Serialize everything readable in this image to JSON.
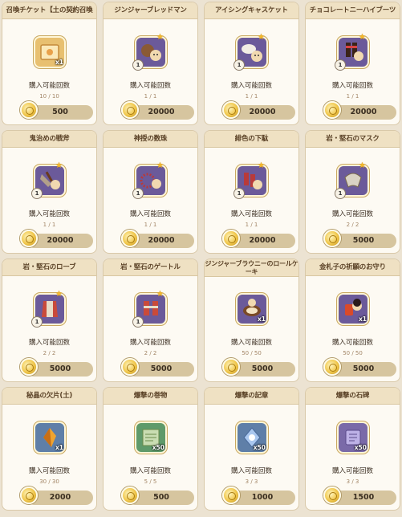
{
  "shop": {
    "purchase_label": "購入可能回数",
    "items": [
      {
        "title": "召喚チケット【土の契約召喚",
        "title_two_line": false,
        "count": "10 / 10",
        "price": "500",
        "qty": "x1",
        "level": "",
        "star": false,
        "tile": "gold",
        "icon": "summon-ticket-icon"
      },
      {
        "title": "ジンジャーブレッドマン",
        "title_two_line": false,
        "count": "1 / 1",
        "price": "20000",
        "qty": "",
        "level": "1",
        "star": true,
        "tile": "purple",
        "icon": "gingerbread-costume-icon"
      },
      {
        "title": "アイシングキャスケット",
        "title_two_line": false,
        "count": "1 / 1",
        "price": "20000",
        "qty": "",
        "level": "1",
        "star": true,
        "tile": "purple",
        "icon": "icing-casquette-icon"
      },
      {
        "title": "チョコレートニーハイブーツ",
        "title_two_line": false,
        "count": "1 / 1",
        "price": "20000",
        "qty": "",
        "level": "1",
        "star": true,
        "tile": "purple",
        "icon": "chocolate-boots-icon"
      },
      {
        "title": "鬼治めの戦斧",
        "title_two_line": false,
        "count": "1 / 1",
        "price": "20000",
        "qty": "",
        "level": "1",
        "star": true,
        "tile": "purple",
        "icon": "battle-axe-icon"
      },
      {
        "title": "神授の数珠",
        "title_two_line": false,
        "count": "1 / 1",
        "price": "20000",
        "qty": "",
        "level": "1",
        "star": true,
        "tile": "purple",
        "icon": "prayer-beads-icon"
      },
      {
        "title": "緋色の下駄",
        "title_two_line": false,
        "count": "1 / 1",
        "price": "20000",
        "qty": "",
        "level": "1",
        "star": true,
        "tile": "purple",
        "icon": "geta-icon"
      },
      {
        "title": "岩・堅石のマスク",
        "title_two_line": false,
        "count": "2 / 2",
        "price": "5000",
        "qty": "",
        "level": "1",
        "star": true,
        "tile": "purple",
        "icon": "stone-mask-icon"
      },
      {
        "title": "岩・堅石のローブ",
        "title_two_line": false,
        "count": "2 / 2",
        "price": "5000",
        "qty": "",
        "level": "1",
        "star": true,
        "tile": "purple",
        "icon": "stone-robe-icon"
      },
      {
        "title": "岩・堅石のゲートル",
        "title_two_line": false,
        "count": "2 / 2",
        "price": "5000",
        "qty": "",
        "level": "1",
        "star": true,
        "tile": "purple",
        "icon": "stone-gaiters-icon"
      },
      {
        "title": "ジンジャーブラウニーのロールケーキ",
        "title_two_line": true,
        "count": "50 / 50",
        "price": "5000",
        "qty": "x1",
        "level": "",
        "star": false,
        "tile": "purple",
        "icon": "roll-cake-icon"
      },
      {
        "title": "金札子の祈願のお守り",
        "title_two_line": false,
        "count": "50 / 50",
        "price": "5000",
        "qty": "x1",
        "level": "",
        "star": false,
        "tile": "purple",
        "icon": "charm-icon"
      },
      {
        "title": "秘晶の欠片(土)",
        "title_two_line": false,
        "count": "30 / 30",
        "price": "2000",
        "qty": "x1",
        "level": "",
        "star": false,
        "tile": "blue",
        "icon": "crystal-shard-icon"
      },
      {
        "title": "爆撃の巻物",
        "title_two_line": false,
        "count": "5 / 5",
        "price": "500",
        "qty": "x50",
        "level": "",
        "star": false,
        "tile": "green",
        "icon": "scroll-icon"
      },
      {
        "title": "爆撃の記章",
        "title_two_line": false,
        "count": "3 / 3",
        "price": "1000",
        "qty": "x50",
        "level": "",
        "star": false,
        "tile": "blue",
        "icon": "insignia-icon"
      },
      {
        "title": "爆撃の石碑",
        "title_two_line": false,
        "count": "3 / 3",
        "price": "1500",
        "qty": "x50",
        "level": "",
        "star": false,
        "tile": "lilac",
        "icon": "stone-tablet-icon"
      }
    ]
  }
}
